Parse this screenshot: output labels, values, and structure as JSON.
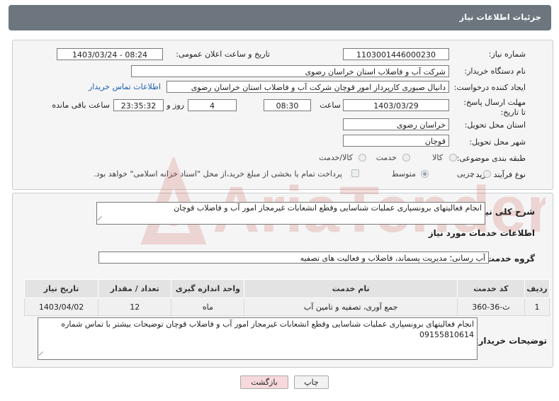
{
  "header": {
    "title": "جزئیات اطلاعات نیاز"
  },
  "fields": {
    "need_number_label": "شماره نیاز:",
    "need_number": "1103001446000230",
    "announce_label": "تاریخ و ساعت اعلان عمومی:",
    "announce_value": "1403/03/24 - 08:24",
    "buyer_org_label": "نام دستگاه خریدار:",
    "buyer_org": "شرکت آب و فاضلاب استان خراسان رضوی",
    "creator_label": "ایجاد کننده درخواست:",
    "creator": "دانیال صبوری کارپرداز امور قوچان  شرکت آب و فاضلاب استان خراسان رضوی",
    "contact_link": "اطلاعات تماس خریدار",
    "deadline_label": "مهلت ارسال پاسخ: تا تاریخ:",
    "deadline_date": "1403/03/29",
    "time_label": "ساعت",
    "deadline_time": "08:30",
    "days_value": "4",
    "days_label": "روز و",
    "remaining_time": "23:35:32",
    "remaining_label": "ساعت باقی مانده",
    "province_label": "استان محل تحویل:",
    "province": "خراسان رضوی",
    "city_label": "شهر محل تحویل:",
    "city": "قوچان",
    "category_label": "طبقه بندی موضوعی:",
    "category_options": [
      "کالا",
      "خدمت",
      "کالا/خدمت"
    ],
    "process_label": "نوع فرآیند خرید :",
    "process_options": [
      "جزیی",
      "متوسط"
    ],
    "payment_note": "پرداخت تمام یا بخشی از مبلغ خرید،از محل \"اسناد خزانه اسلامی\" خواهد بود."
  },
  "summary": {
    "label": "شرح کلی نیاز:",
    "text": "انجام فعالیتهای برونسپاری عملیات شناسایی وقطع انشعابات غیرمجاز امور آب و فاضلاب قوچان"
  },
  "services": {
    "title": "اطلاعات خدمات مورد نیاز",
    "group_label": "گروه خدمت:",
    "group_value": "آب رسانی؛ مدیریت پسماند، فاضلاب و فعالیت های تصفیه",
    "columns": [
      "ردیف",
      "کد خدمت",
      "نام خدمت",
      "واحد اندازه گیری",
      "تعداد / مقدار",
      "تاریخ نیاز"
    ],
    "rows": [
      {
        "row": "1",
        "code": "ث-36-360",
        "name": "جمع آوری، تصفیه و تامین آب",
        "unit": "ماه",
        "qty": "12",
        "date": "1403/04/02"
      }
    ]
  },
  "buyer_notes": {
    "label": "توضیحات خریدار:",
    "text": "انجام فعالیتهای برونسپاری عملیات شناسایی وقطع انشعابات غیرمجاز امور آب و فاضلاب قوچان توضیحات بیشتر با تماس شماره 09155810614"
  },
  "buttons": {
    "print": "چاپ",
    "back": "بازگشت"
  },
  "watermark": {
    "text": "AriaTender.net"
  },
  "colors": {
    "header_bg": "#6d767e",
    "link": "#1a5fb4",
    "back_button_bg": "#f7d9dc",
    "watermark": "#c0392b"
  }
}
